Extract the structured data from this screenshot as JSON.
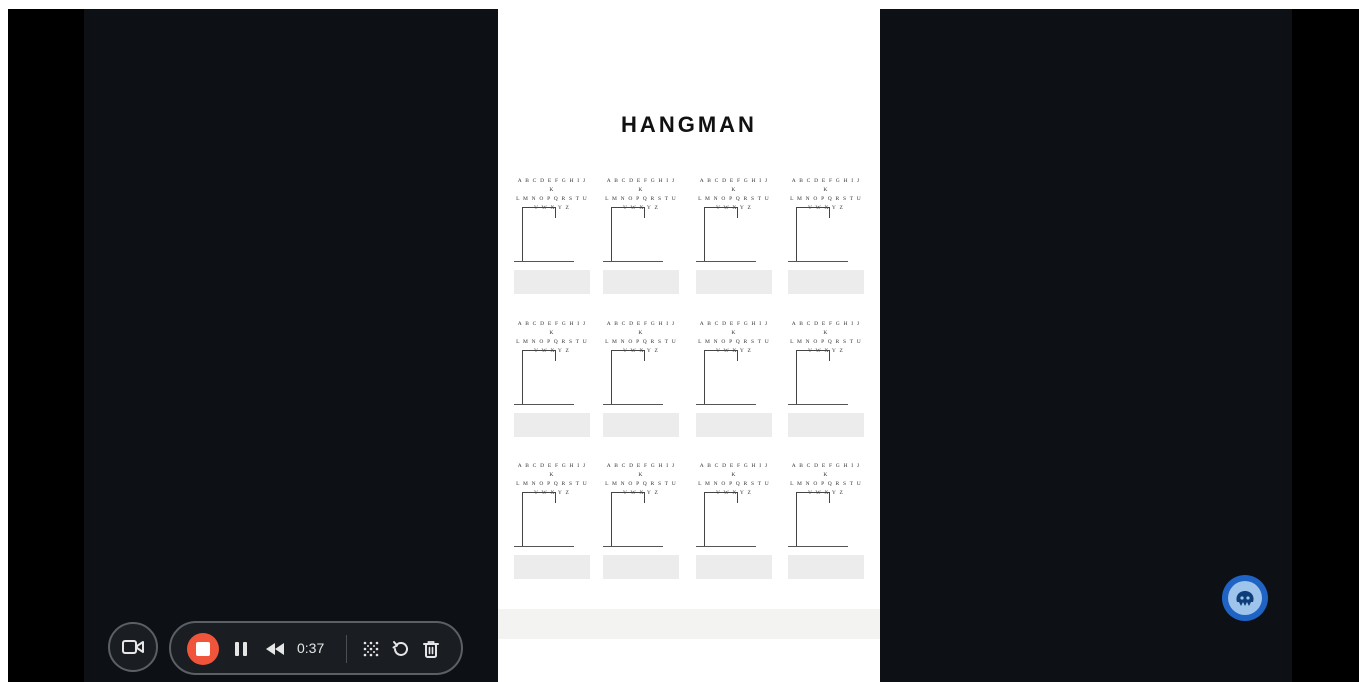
{
  "document": {
    "title": "HANGMAN",
    "letters_text": "A B C D E F G H I J K\nL M N O P Q R S T U\nV W X Y Z",
    "cell_count": 12
  },
  "recorder": {
    "elapsed": "0:37"
  },
  "colors": {
    "stop": "#f0543a",
    "control_bg": "#1a1d22",
    "stage": "#0d1116",
    "avatar": "#1f63c4"
  },
  "icons": [
    "camera-icon",
    "stop-icon",
    "pause-icon",
    "rewind-icon",
    "grid-icon",
    "restart-icon",
    "trash-icon",
    "mascot-icon"
  ]
}
